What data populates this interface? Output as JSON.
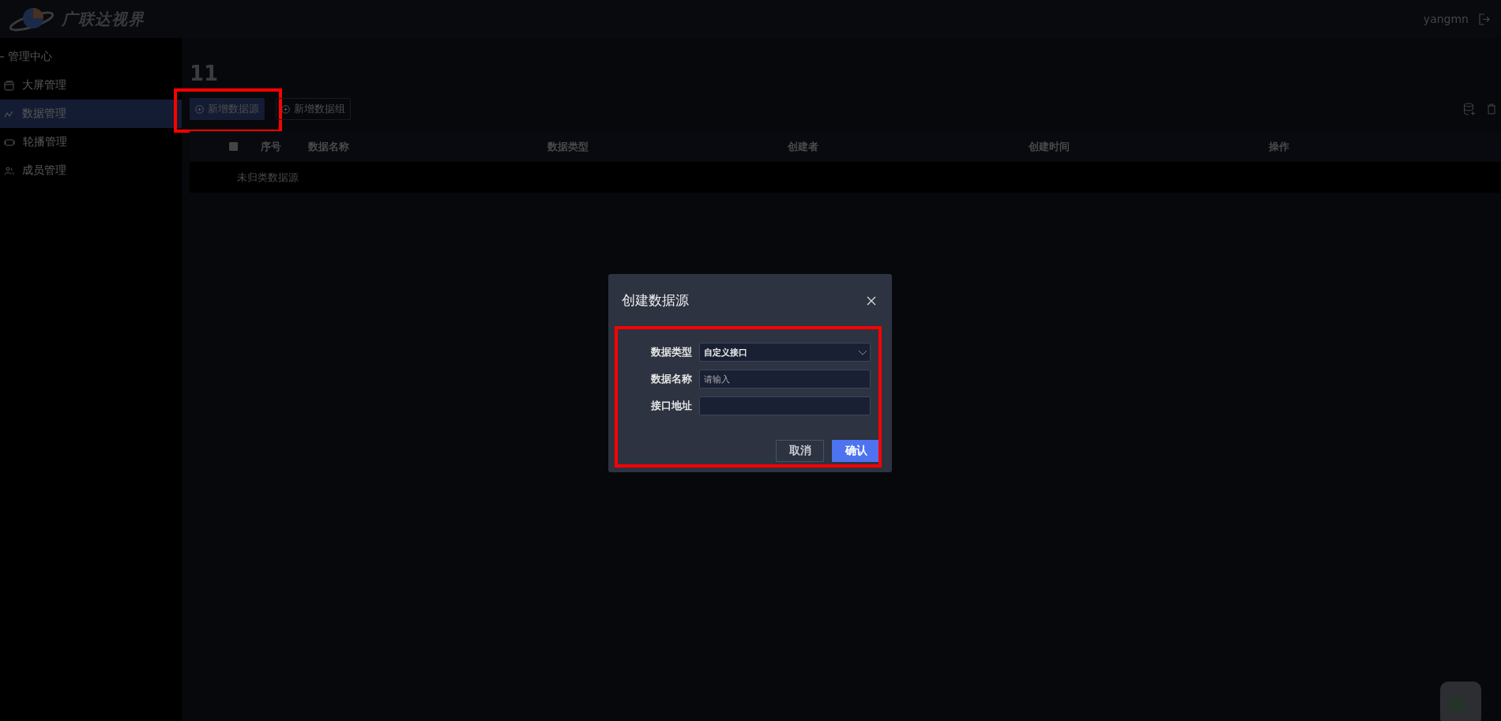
{
  "header": {
    "logo_text": "广联达视界",
    "user": "yangmn"
  },
  "sidebar": {
    "section": {
      "label": "管理中心",
      "expanded": true
    },
    "items": [
      {
        "label": "大屏管理",
        "selected": false
      },
      {
        "label": "数据管理",
        "selected": true
      },
      {
        "label": "轮播管理",
        "selected": false
      },
      {
        "label": "成员管理",
        "selected": false
      }
    ]
  },
  "page_title": "11",
  "toolbar": [
    {
      "label": "新增数据源",
      "kind": "primary"
    },
    {
      "label": "新增数据组",
      "kind": "outline"
    }
  ],
  "table": {
    "select_all": {
      "checked": false
    },
    "columns": [
      "序号",
      "数据名称",
      "数据类型",
      "创建者",
      "创建时间",
      "操作"
    ],
    "groups": [
      {
        "label": "未归类数据源"
      }
    ]
  },
  "dialog": {
    "title": "创建数据源",
    "fields": [
      {
        "label": "数据类型",
        "kind": "select",
        "value": "自定义接口"
      },
      {
        "label": "数据名称",
        "kind": "text",
        "placeholder": "请输入"
      },
      {
        "label": "接口地址",
        "kind": "text"
      }
    ],
    "buttons": [
      {
        "label": "取消",
        "kind": "secondary"
      },
      {
        "label": "确认",
        "kind": "primary"
      }
    ]
  }
}
